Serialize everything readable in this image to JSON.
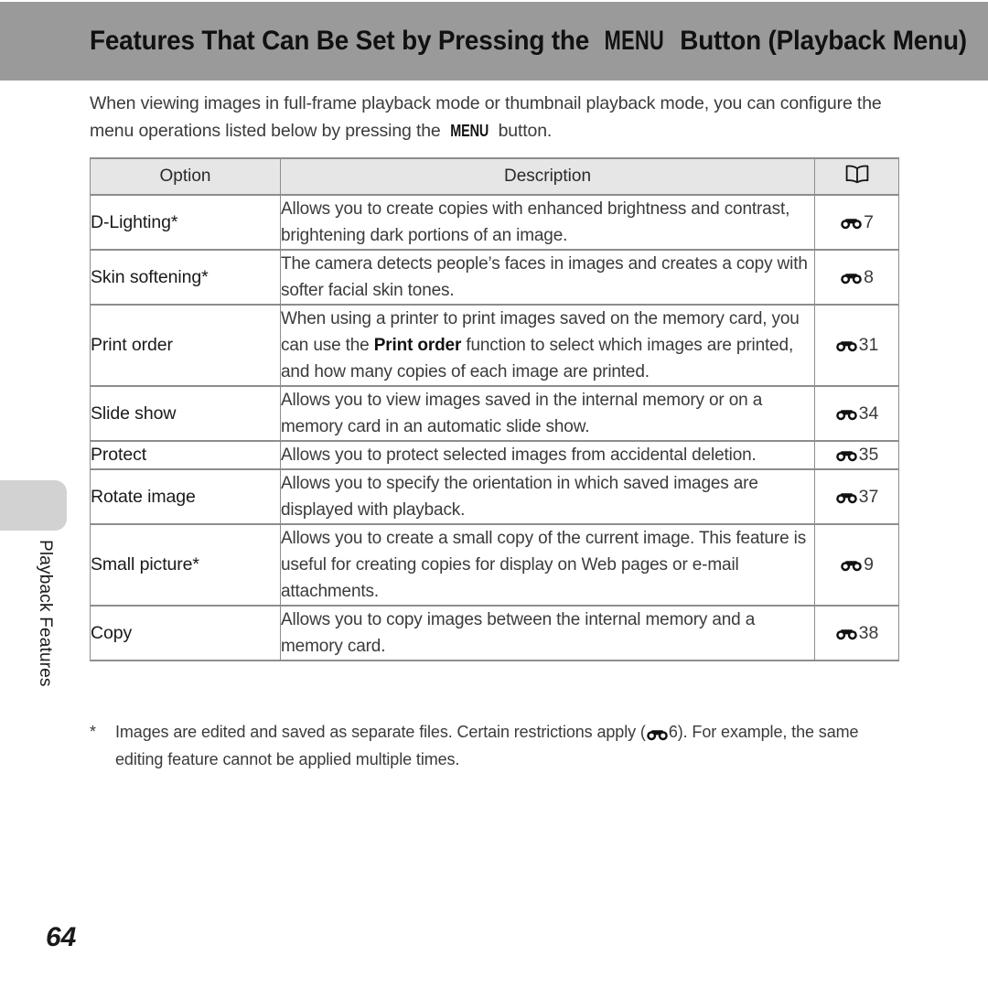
{
  "page": {
    "title_prefix": "Features That Can Be Set by Pressing the ",
    "title_menu": "MENU",
    "title_suffix": " Button (Playback Menu)",
    "number": "64"
  },
  "intro": {
    "line1": "When viewing images in full-frame playback mode or thumbnail playback mode, you can",
    "line2_before": "configure the menu operations listed below by pressing the ",
    "line2_menu": "MENU",
    "line2_after": " button."
  },
  "table": {
    "headers": {
      "option": "Option",
      "description": "Description",
      "reference_icon": "open-book-icon"
    },
    "rows": [
      {
        "option": "D-Lighting*",
        "description_pre": "Allows you to create copies with enhanced brightness and contrast, brightening dark portions of an image.",
        "description_bold": "",
        "description_post": "",
        "ref_icon": "binoculars-icon",
        "ref_page": "7"
      },
      {
        "option": "Skin softening*",
        "description_pre": "The camera detects people’s faces in images and creates a copy with softer facial skin tones.",
        "description_bold": "",
        "description_post": "",
        "ref_icon": "binoculars-icon",
        "ref_page": "8"
      },
      {
        "option": "Print order",
        "description_pre": "When using a printer to print images saved on the memory card, you can use the ",
        "description_bold": "Print order",
        "description_post": " function to select which images are printed, and how many copies of each image are printed.",
        "ref_icon": "binoculars-icon",
        "ref_page": "31"
      },
      {
        "option": "Slide show",
        "description_pre": "Allows you to view images saved in the internal memory or on a memory card in an automatic slide show.",
        "description_bold": "",
        "description_post": "",
        "ref_icon": "binoculars-icon",
        "ref_page": "34"
      },
      {
        "option": "Protect",
        "description_pre": "Allows you to protect selected images from accidental deletion.",
        "description_bold": "",
        "description_post": "",
        "ref_icon": "binoculars-icon",
        "ref_page": "35"
      },
      {
        "option": "Rotate image",
        "description_pre": "Allows you to specify the orientation in which saved images are displayed with playback.",
        "description_bold": "",
        "description_post": "",
        "ref_icon": "binoculars-icon",
        "ref_page": "37"
      },
      {
        "option": "Small picture*",
        "description_pre": "Allows you to create a small copy of the current image. This feature is useful for creating copies for display on Web pages or e-mail attachments.",
        "description_bold": "",
        "description_post": "",
        "ref_icon": "binoculars-icon",
        "ref_page": "9"
      },
      {
        "option": "Copy",
        "description_pre": "Allows you to copy images between the internal memory and a memory card.",
        "description_bold": "",
        "description_post": "",
        "ref_icon": "binoculars-icon",
        "ref_page": "38"
      }
    ]
  },
  "footnote": {
    "marker": "*",
    "text_before": "Images are edited and saved as separate files. Certain restrictions apply (",
    "ref_icon": "binoculars-icon",
    "ref_page": "6",
    "text_after": "). For example, the same editing feature cannot be applied multiple times."
  },
  "side_tab": {
    "label": "Playback Features"
  },
  "colors": {
    "banner": "#9a9a9a",
    "table_header_bg": "#e6e6e6",
    "rule": "#8d8d8d",
    "side_tab": "#d2d2d2"
  }
}
